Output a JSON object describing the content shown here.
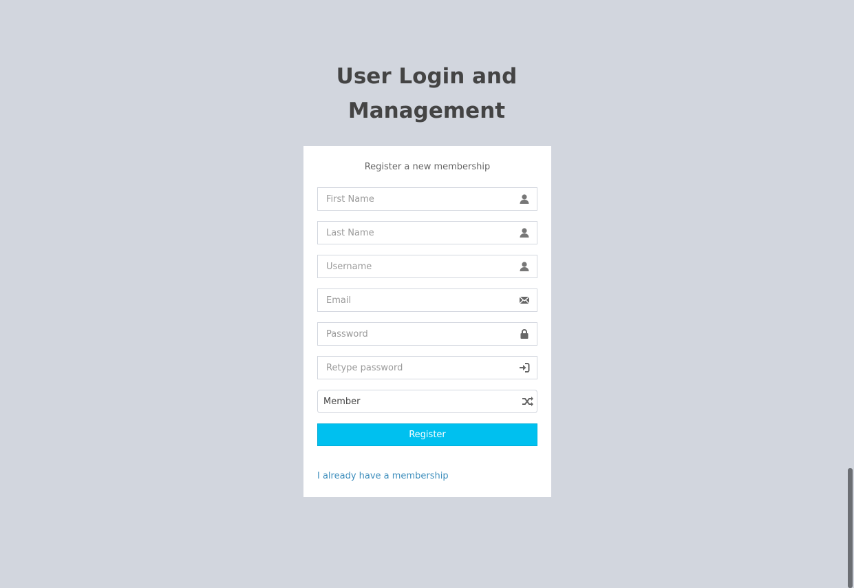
{
  "header": {
    "title": "User Login and Management"
  },
  "form": {
    "message": "Register a new membership",
    "fields": [
      {
        "placeholder": "First Name",
        "icon": "user-icon"
      },
      {
        "placeholder": "Last Name",
        "icon": "user-icon"
      },
      {
        "placeholder": "Username",
        "icon": "user-icon"
      },
      {
        "placeholder": "Email",
        "icon": "envelope-icon"
      },
      {
        "placeholder": "Password",
        "icon": "lock-icon"
      },
      {
        "placeholder": "Retype password",
        "icon": "log-in-icon"
      }
    ],
    "role_select": {
      "value": "Member",
      "icon": "random-icon"
    },
    "register_label": "Register",
    "login_link": "I already have a membership",
    "colors": {
      "button": "#00c0ef",
      "link": "#3c8dbc",
      "background": "#d2d6de"
    }
  }
}
